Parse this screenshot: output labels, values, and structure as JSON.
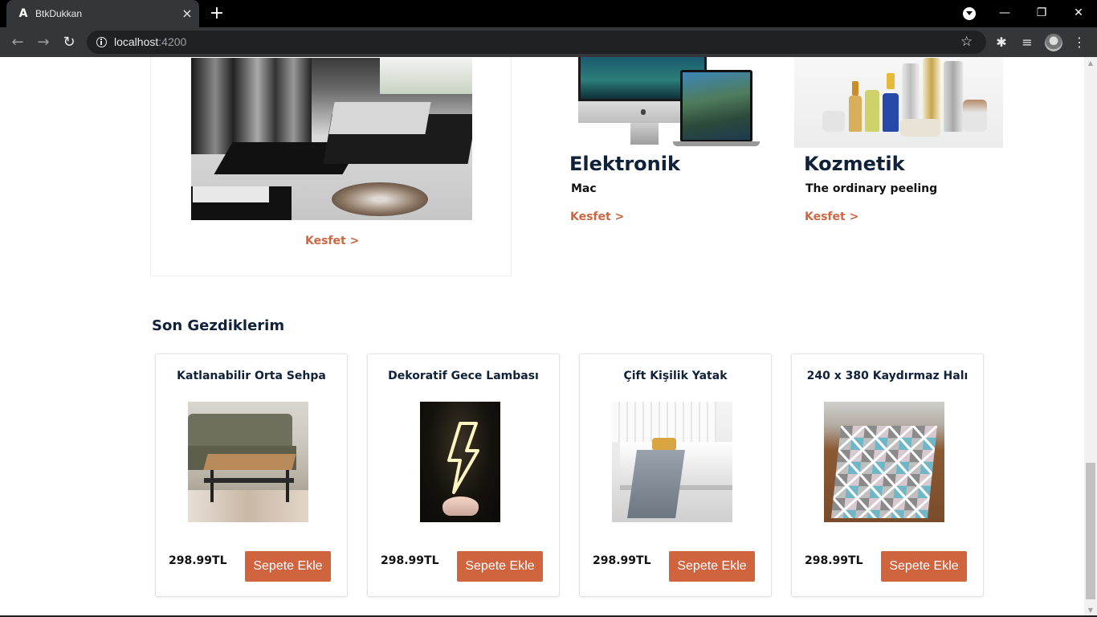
{
  "browser": {
    "tab_title": "BtkDukkan",
    "tab_favicon": "A",
    "url_host": "localhost",
    "url_port": ":4200"
  },
  "icons": {
    "tab_close": "×",
    "new_tab": "+",
    "back": "←",
    "forward": "→",
    "reload": "↻",
    "star": "☆",
    "extensions": "✱",
    "media": "≡",
    "menu": "⋮",
    "minimize": "—",
    "restore": "❐",
    "close": "✕"
  },
  "featured": {
    "cta": "Kesfet >"
  },
  "categories": [
    {
      "title": "Elektronik",
      "subtitle": "Mac",
      "cta": "Kesfet >"
    },
    {
      "title": "Kozmetik",
      "subtitle": "The ordinary peeling",
      "cta": "Kesfet >"
    }
  ],
  "recent": {
    "title": "Son Gezdiklerim",
    "products": [
      {
        "name": "Katlanabilir Orta Sehpa",
        "price": "298.99TL",
        "button": "Sepete Ekle"
      },
      {
        "name": "Dekoratif Gece Lambası",
        "price": "298.99TL",
        "button": "Sepete Ekle"
      },
      {
        "name": "Çift Kişilik Yatak",
        "price": "298.99TL",
        "button": "Sepete Ekle"
      },
      {
        "name": "240 x 380 Kaydırmaz Halı",
        "price": "298.99TL",
        "button": "Sepete Ekle"
      }
    ]
  },
  "colors": {
    "accent": "#d0643f",
    "heading": "#10213a",
    "chrome_dark": "#35363a"
  }
}
